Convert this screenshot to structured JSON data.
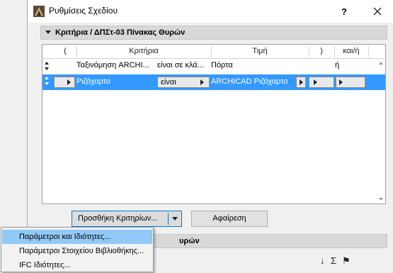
{
  "window": {
    "title": "Ρυθμίσεις Σχεδίου",
    "help_label": "?",
    "close_label": "✕"
  },
  "criteria_section": {
    "title": "Κριτήρια / ΔΠΣτ-03 Πίνακας Θυρών"
  },
  "table": {
    "headers": {
      "open_paren": "(",
      "criteria": "Κριτήρια",
      "value": "Τιμή",
      "close_paren": ")",
      "and_or": "και/ή"
    },
    "rows": [
      {
        "criterion": "Ταξινόμηση ARCHI...",
        "operator": "είναι σε κλά...",
        "value": "Πόρτα",
        "and_or": "ή",
        "selected": false
      },
      {
        "criterion": "Ριζόχαρτο",
        "operator": "είναι",
        "value": "ARCHICAD Ριζόχαρτο",
        "and_or": "",
        "selected": true
      }
    ]
  },
  "buttons": {
    "add_label": "Προσθήκη Κριτηρίων...",
    "remove_label": "Αφαίρεση"
  },
  "second_section": {
    "title": "υρών"
  },
  "toolbar_icons": {
    "sort": "↓",
    "sum": "Σ",
    "pin": "⚑"
  },
  "menu": {
    "items": [
      {
        "label": "Παράμετροι και Ιδιότητες...",
        "highlighted": true
      },
      {
        "label": "Παράμετροι Στοιχείου Βιβλιοθήκης...",
        "highlighted": false
      },
      {
        "label": "IFC Ιδιότητες...",
        "highlighted": false
      }
    ]
  },
  "colors": {
    "selection": "#3399ff",
    "menu_highlight": "#91c9f7",
    "focus_border": "#0078d7"
  }
}
